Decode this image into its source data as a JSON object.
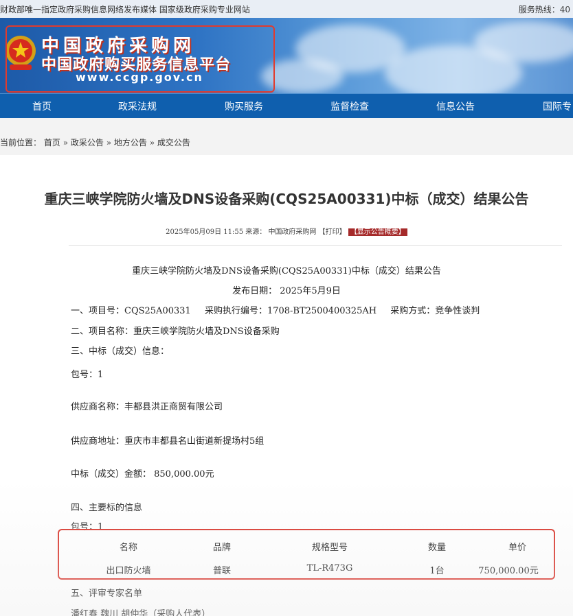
{
  "topbar": {
    "left_text": "财政部唯一指定政府采购信息网络发布媒体 国家级政府采购专业网站",
    "right_text": "服务热线：40"
  },
  "logo": {
    "title": "中国政府采购网",
    "subtitle": "中国政府购买服务信息平台",
    "url": "www.ccgp.gov.cn"
  },
  "nav": [
    "首页",
    "政采法规",
    "购买服务",
    "监督检查",
    "信息公告",
    "国际专"
  ],
  "breadcrumb": {
    "prefix": "当前位置：",
    "items": [
      "首页",
      "政采公告",
      "地方公告",
      "成交公告"
    ],
    "separator": "»"
  },
  "article": {
    "title": "重庆三峡学院防火墙及DNS设备采购(CQS25A00331)中标（成交）结果公告",
    "meta_date": "2025年05月09日 11:55 来源：",
    "meta_source": "中国政府采购网",
    "meta_print": "【打印】",
    "meta_tag": "【显示公告概要】",
    "inner_title": "重庆三峡学院防火墙及DNS设备采购(CQS25A00331)中标（成交）结果公告",
    "publish_date": "发布日期： 2025年5月9日",
    "project_no": "一、项目号：CQS25A00331",
    "exec_no": "采购执行编号：1708-BT2500400325AH",
    "method": "采购方式：竞争性谈判",
    "project_name": "二、项目名称：重庆三峡学院防火墙及DNS设备采购",
    "award_info": "三、中标（成交）信息：",
    "package": "包号：1",
    "supplier_name": "供应商名称：丰都县洪正商贸有限公司",
    "supplier_addr": "供应商地址：重庆市丰都县名山街道新提场村5组",
    "amount": "中标（成交）金额： 850,000.00元",
    "main_items": "四、主要标的信息",
    "package2": "包号：1",
    "experts": "五、评审专家名单",
    "experts_names": "潘红春 魏川 胡仲华（采购人代表）"
  },
  "table": {
    "headers": [
      "名称",
      "品牌",
      "规格型号",
      "数量",
      "单价"
    ],
    "row": [
      "出口防火墙",
      "普联",
      "TL-R473G",
      "1台",
      "750,000.00元"
    ]
  },
  "colors": {
    "nav_bg": "#0f5fae",
    "highlight_border": "#d9342a",
    "tag_bg": "#a52a2a"
  }
}
